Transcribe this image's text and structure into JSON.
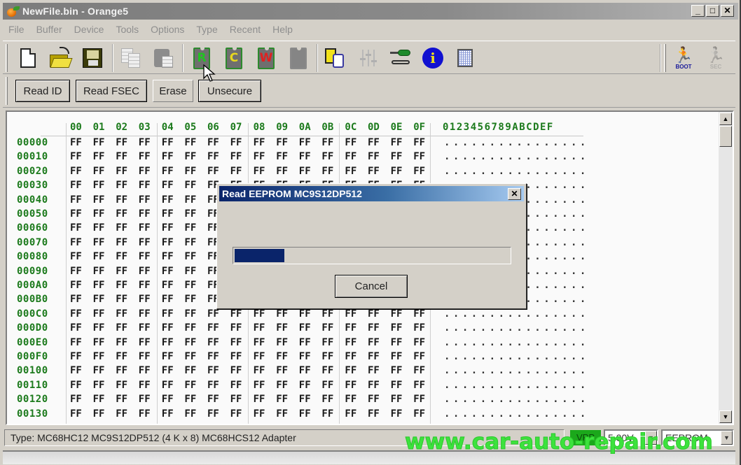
{
  "window": {
    "title": "NewFile.bin - Orange5",
    "controls": {
      "minimize": "_",
      "maximize": "□",
      "close": "✕"
    }
  },
  "menu": [
    "File",
    "Buffer",
    "Device",
    "Tools",
    "Options",
    "Type",
    "Recent",
    "Help"
  ],
  "toolbar": {
    "chip_buttons": [
      {
        "name": "read",
        "letter": "R",
        "letter_color": "#21c421"
      },
      {
        "name": "compare",
        "letter": "C",
        "letter_color": "#e8d81e"
      },
      {
        "name": "write",
        "letter": "W",
        "letter_color": "#e02020"
      },
      {
        "name": "blank",
        "letter": "",
        "letter_color": "#858585"
      }
    ],
    "boot_label": "BOOT",
    "sec_label": "SEC",
    "info_glyph": "i",
    "run_glyph": "🏃"
  },
  "action_buttons": [
    "Read ID",
    "Read FSEC",
    "Erase",
    "Unsecure"
  ],
  "hex_view": {
    "column_headers": [
      "00",
      "01",
      "02",
      "03",
      "04",
      "05",
      "06",
      "07",
      "08",
      "09",
      "0A",
      "0B",
      "0C",
      "0D",
      "0E",
      "0F"
    ],
    "ascii_header": "0123456789ABCDEF",
    "rows": [
      {
        "addr": "00000",
        "byte": "FF",
        "ascii": "................"
      },
      {
        "addr": "00010",
        "byte": "FF",
        "ascii": "................"
      },
      {
        "addr": "00020",
        "byte": "FF",
        "ascii": "................"
      },
      {
        "addr": "00030",
        "byte": "FF",
        "ascii": "................"
      },
      {
        "addr": "00040",
        "byte": "FF",
        "ascii": "................"
      },
      {
        "addr": "00050",
        "byte": "FF",
        "ascii": "................"
      },
      {
        "addr": "00060",
        "byte": "FF",
        "ascii": "................"
      },
      {
        "addr": "00070",
        "byte": "FF",
        "ascii": "................"
      },
      {
        "addr": "00080",
        "byte": "FF",
        "ascii": "................"
      },
      {
        "addr": "00090",
        "byte": "FF",
        "ascii": "................"
      },
      {
        "addr": "000A0",
        "byte": "FF",
        "ascii": "................"
      },
      {
        "addr": "000B0",
        "byte": "FF",
        "ascii": "................"
      },
      {
        "addr": "000C0",
        "byte": "FF",
        "ascii": "................"
      },
      {
        "addr": "000D0",
        "byte": "FF",
        "ascii": "................"
      },
      {
        "addr": "000E0",
        "byte": "FF",
        "ascii": "................"
      },
      {
        "addr": "000F0",
        "byte": "FF",
        "ascii": "................"
      },
      {
        "addr": "00100",
        "byte": "FF",
        "ascii": "................"
      },
      {
        "addr": "00110",
        "byte": "FF",
        "ascii": "................"
      },
      {
        "addr": "00120",
        "byte": "FF",
        "ascii": "................"
      },
      {
        "addr": "00130",
        "byte": "FF",
        "ascii": "................"
      }
    ],
    "scroll_up": "▲",
    "scroll_down": "▼"
  },
  "dialog": {
    "title": "Read EEPROM MC9S12DP512",
    "progress_percent": 18,
    "cancel_label": "Cancel",
    "close": "✕"
  },
  "status": {
    "type_text": "Type: MC68HC12 MC9S12DP512 (4 K x 8)   MC68HCS12 Adapter",
    "indicator": "VPP",
    "voltage": "5.00V",
    "memory": "EEPROM",
    "dropdown_glyph": "▼"
  },
  "watermark": "www.car-auto-repair.com"
}
